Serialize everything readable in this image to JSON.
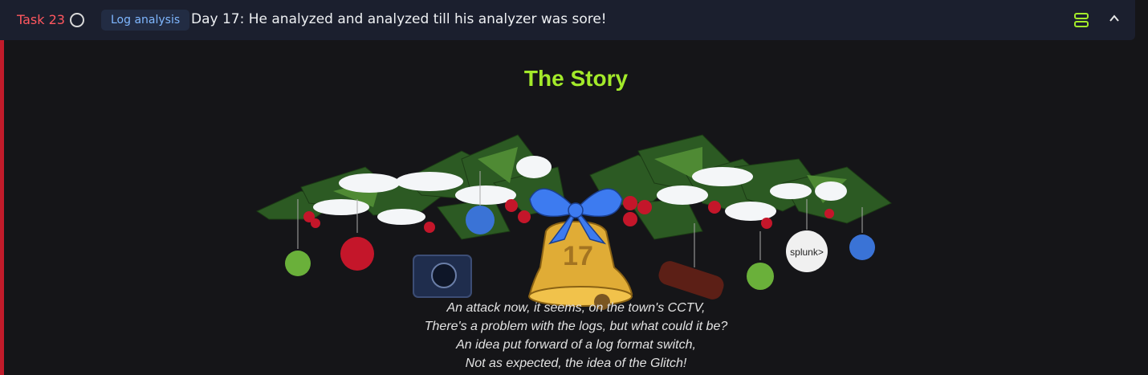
{
  "task": {
    "number_label": "Task 23",
    "tag": "Log analysis",
    "title": "Day 17: He analyzed and analyzed till his analyzer was sore!",
    "icons": {
      "status": "circle-outline-icon",
      "server": "server-icon",
      "collapse": "chevron-up-icon"
    }
  },
  "story": {
    "heading": "The Story",
    "image": {
      "bell_number": "17",
      "ornament_brand": "splunk>"
    },
    "poem_lines": [
      "An attack now, it seems, on the town's CCTV,",
      "There's a problem with the logs, but what could it be?",
      "An idea put forward of a log format switch,",
      "Not as expected, the idea of the Glitch!"
    ]
  },
  "colors": {
    "header_bg": "#1b1f2e",
    "page_bg": "#151518",
    "accent_red": "#ff575f",
    "accent_green": "#a3ea2a",
    "tag_text": "#7fb7ff"
  }
}
